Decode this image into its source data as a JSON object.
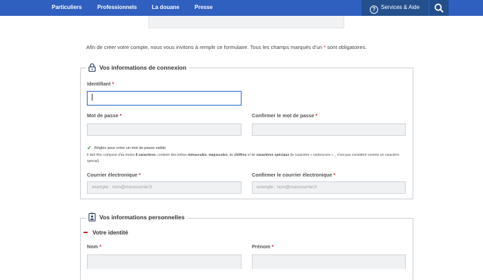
{
  "nav": {
    "items": [
      "Particuliers",
      "Professionnels",
      "La douane",
      "Presse"
    ],
    "services_label": "Services & Aide",
    "search_icon": "search-icon"
  },
  "intro": {
    "text_before": "Afin de créer votre compte, nous vous invitons à remplir ce formulaire. Tous les champs marqués d'un ",
    "star": "*",
    "text_after": " sont obligatoires."
  },
  "connexion": {
    "legend": "Vos informations de connexion",
    "icon": "lock-icon",
    "identifiant_label": "Identifiant",
    "identifiant_value": "",
    "password_label": "Mot de passe",
    "password_confirm_label": "Confirmer le mot de passe",
    "rules_title": "Règles pour créer un mot de passe valide",
    "rules_intro": "Il doit être composé d'au moins ",
    "rules_min": "8 caractères",
    "rules_mid1": ", contenir des lettres ",
    "rules_minus": "minuscules",
    "rules_sep": ", ",
    "rules_majus": "majuscules",
    "rules_mid2": ", de ",
    "rules_chiffres": "chiffres",
    "rules_mid3": " et de ",
    "rules_speciaux": "caractères spéciaux",
    "rules_tail": " (le caractère « underscore » _ n'est pas considéré comme un caractère spécial).",
    "email_label": "Courrier électronique",
    "email_placeholder": "exemple : nom@moncourriel.fr",
    "email_confirm_label": "Confirmer le courrier électronique",
    "email_confirm_placeholder": "exemple : nom@moncourriel.fr"
  },
  "personnel": {
    "legend": "Vos informations personnelles",
    "icon": "id-badge-icon",
    "identite": "Votre identité",
    "nom_label": "Nom",
    "prenom_label": "Prénom"
  },
  "required_mark": "*",
  "colors": {
    "nav_bg": "#2f5fbf",
    "nav_dark": "#24508e",
    "required": "#d1202a",
    "focus": "#2f6fd6",
    "check": "#2c8a3c"
  }
}
